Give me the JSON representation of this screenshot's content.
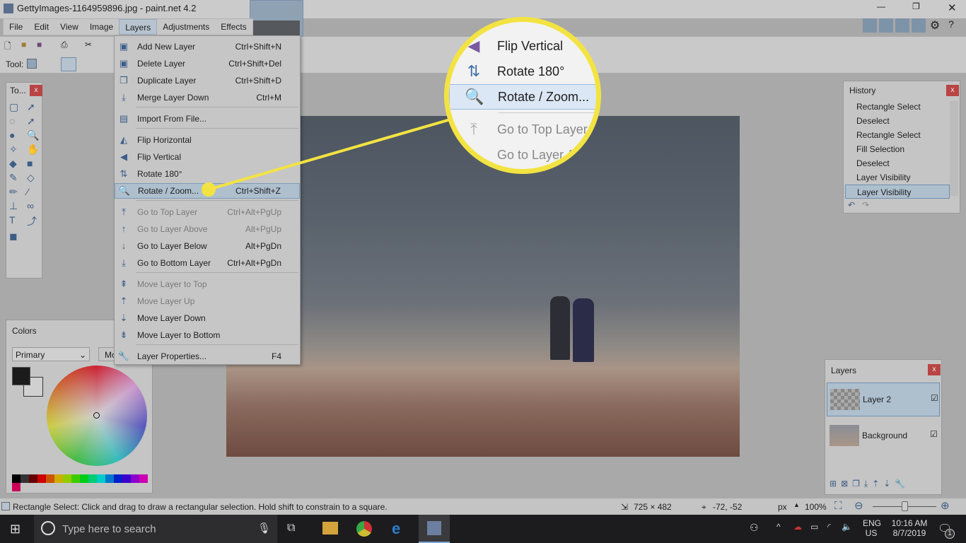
{
  "window": {
    "title": "GettyImages-1164959896.jpg - paint.net 4.2"
  },
  "menubar": [
    "File",
    "Edit",
    "View",
    "Image",
    "Layers",
    "Adjustments",
    "Effects"
  ],
  "toolbar": {
    "tool_label": "Tool:"
  },
  "layers_menu": {
    "items": [
      {
        "label": "Add New Layer",
        "shortcut": "Ctrl+Shift+N",
        "icon": "add-layer-icon",
        "enabled": true
      },
      {
        "label": "Delete Layer",
        "shortcut": "Ctrl+Shift+Del",
        "icon": "delete-layer-icon",
        "enabled": true
      },
      {
        "label": "Duplicate Layer",
        "shortcut": "Ctrl+Shift+D",
        "icon": "duplicate-layer-icon",
        "enabled": true
      },
      {
        "label": "Merge Layer Down",
        "shortcut": "Ctrl+M",
        "icon": "merge-layer-icon",
        "enabled": true
      },
      {
        "label": "Import From File...",
        "shortcut": "",
        "icon": "import-icon",
        "enabled": true
      },
      {
        "label": "Flip Horizontal",
        "shortcut": "",
        "icon": "flip-horizontal-icon",
        "enabled": true
      },
      {
        "label": "Flip Vertical",
        "shortcut": "",
        "icon": "flip-vertical-icon",
        "enabled": true
      },
      {
        "label": "Rotate 180°",
        "shortcut": "",
        "icon": "rotate-180-icon",
        "enabled": true
      },
      {
        "label": "Rotate / Zoom...",
        "shortcut": "Ctrl+Shift+Z",
        "icon": "rotate-zoom-icon",
        "enabled": true,
        "highlighted": true
      },
      {
        "label": "Go to Top Layer",
        "shortcut": "Ctrl+Alt+PgUp",
        "icon": "arrow-top-icon",
        "enabled": false
      },
      {
        "label": "Go to Layer Above",
        "shortcut": "Alt+PgUp",
        "icon": "arrow-up-icon",
        "enabled": false
      },
      {
        "label": "Go to Layer Below",
        "shortcut": "Alt+PgDn",
        "icon": "arrow-down-icon",
        "enabled": true
      },
      {
        "label": "Go to Bottom Layer",
        "shortcut": "Ctrl+Alt+PgDn",
        "icon": "arrow-bottom-icon",
        "enabled": true
      },
      {
        "label": "Move Layer to Top",
        "shortcut": "",
        "icon": "move-top-icon",
        "enabled": false
      },
      {
        "label": "Move Layer Up",
        "shortcut": "",
        "icon": "move-up-icon",
        "enabled": false
      },
      {
        "label": "Move Layer Down",
        "shortcut": "",
        "icon": "move-down-icon",
        "enabled": true
      },
      {
        "label": "Move Layer to Bottom",
        "shortcut": "",
        "icon": "move-bottom-icon",
        "enabled": true
      },
      {
        "label": "Layer Properties...",
        "shortcut": "F4",
        "icon": "wrench-icon",
        "enabled": true
      }
    ]
  },
  "magnifier": {
    "items": [
      "Flip Vertical",
      "Rotate 180°",
      "Rotate / Zoom...",
      "Go to Top Layer",
      "Go to Layer Abo"
    ],
    "border_color": "#f3e342"
  },
  "tools_panel": {
    "title": "To..."
  },
  "colors_panel": {
    "title": "Colors",
    "mode": "Primary",
    "more_label": "Mo",
    "palette": [
      "#000000",
      "#404040",
      "#7f0000",
      "#ff0000",
      "#ff6a00",
      "#ffd800",
      "#b6ff00",
      "#4cff00",
      "#00ff21",
      "#00ff90",
      "#00ffff",
      "#0094ff",
      "#0026ff",
      "#4800ff",
      "#b200ff",
      "#ff00dc",
      "#ff006e"
    ]
  },
  "history_panel": {
    "title": "History",
    "items": [
      "Rectangle Select",
      "Deselect",
      "Rectangle Select",
      "Fill Selection",
      "Deselect",
      "Layer Visibility",
      "Layer Visibility"
    ]
  },
  "layers_panel": {
    "title": "Layers",
    "layers": [
      {
        "name": "Layer 2",
        "visible": true,
        "selected": true
      },
      {
        "name": "Background",
        "visible": true,
        "selected": false
      }
    ]
  },
  "statusbar": {
    "hint": "Rectangle Select: Click and drag to draw a rectangular selection. Hold shift to constrain to a square.",
    "image_size": "725 × 482",
    "cursor": "-72, -52",
    "units": "px",
    "zoom": "100%",
    "zoom_slider": 0.5
  },
  "taskbar": {
    "search_placeholder": "Type here to search",
    "lang1": "ENG",
    "lang2": "US",
    "time": "10:16 AM",
    "date": "8/7/2019",
    "notifications": "1"
  }
}
